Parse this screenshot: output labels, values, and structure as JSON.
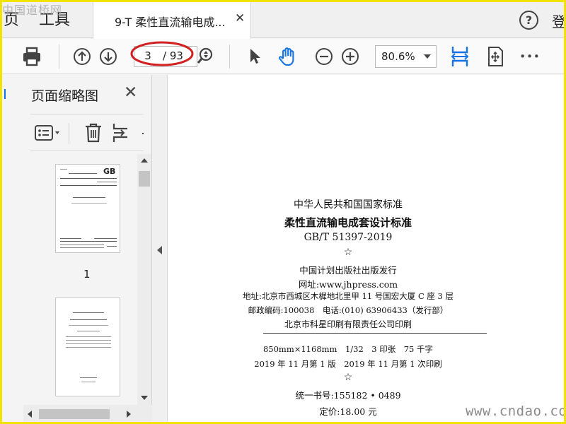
{
  "watermarks": {
    "top_left": "中国道桥网",
    "bottom_right": "www.cndao.com"
  },
  "tabs": {
    "home_partial": "页",
    "tools": "工具",
    "document_title": "9-T 柔性直流输电成...",
    "close_glyph": "✕"
  },
  "header": {
    "help_glyph": "?",
    "login_partial": "登"
  },
  "toolbar": {
    "page_current": "3",
    "page_total": "/ 93",
    "zoom": "80.6%",
    "more_glyph": "•••"
  },
  "thumbnail_panel": {
    "title": "页面缩略图",
    "close_glyph": "✕",
    "thumb1_label": "1"
  },
  "page": {
    "lines": [
      "中华人民共和国国家标准",
      "柔性直流输电成套设计标准",
      "GB/T 51397-2019",
      "☆",
      "中国计划出版社出版发行",
      "网址:www.jhpress.com",
      "地址:北京市西城区木樨地北里甲 11 号国宏大厦 C 座 3 层",
      "邮政编码:100038　电话:(010) 63906433（发行部）",
      "北京市科星印刷有限责任公司印刷",
      "850mm×1168mm　1/32　3 印张　75 千字",
      "2019 年 11 月第 1 版　2019 年 11 月第 1 次印刷",
      "☆",
      "统一书号:155182 • 0489",
      "定价:18.00 元"
    ]
  },
  "colors": {
    "accent_blue": "#1473e6",
    "annotation_red": "#d21f1f",
    "frame_yellow": "#f2e400"
  }
}
